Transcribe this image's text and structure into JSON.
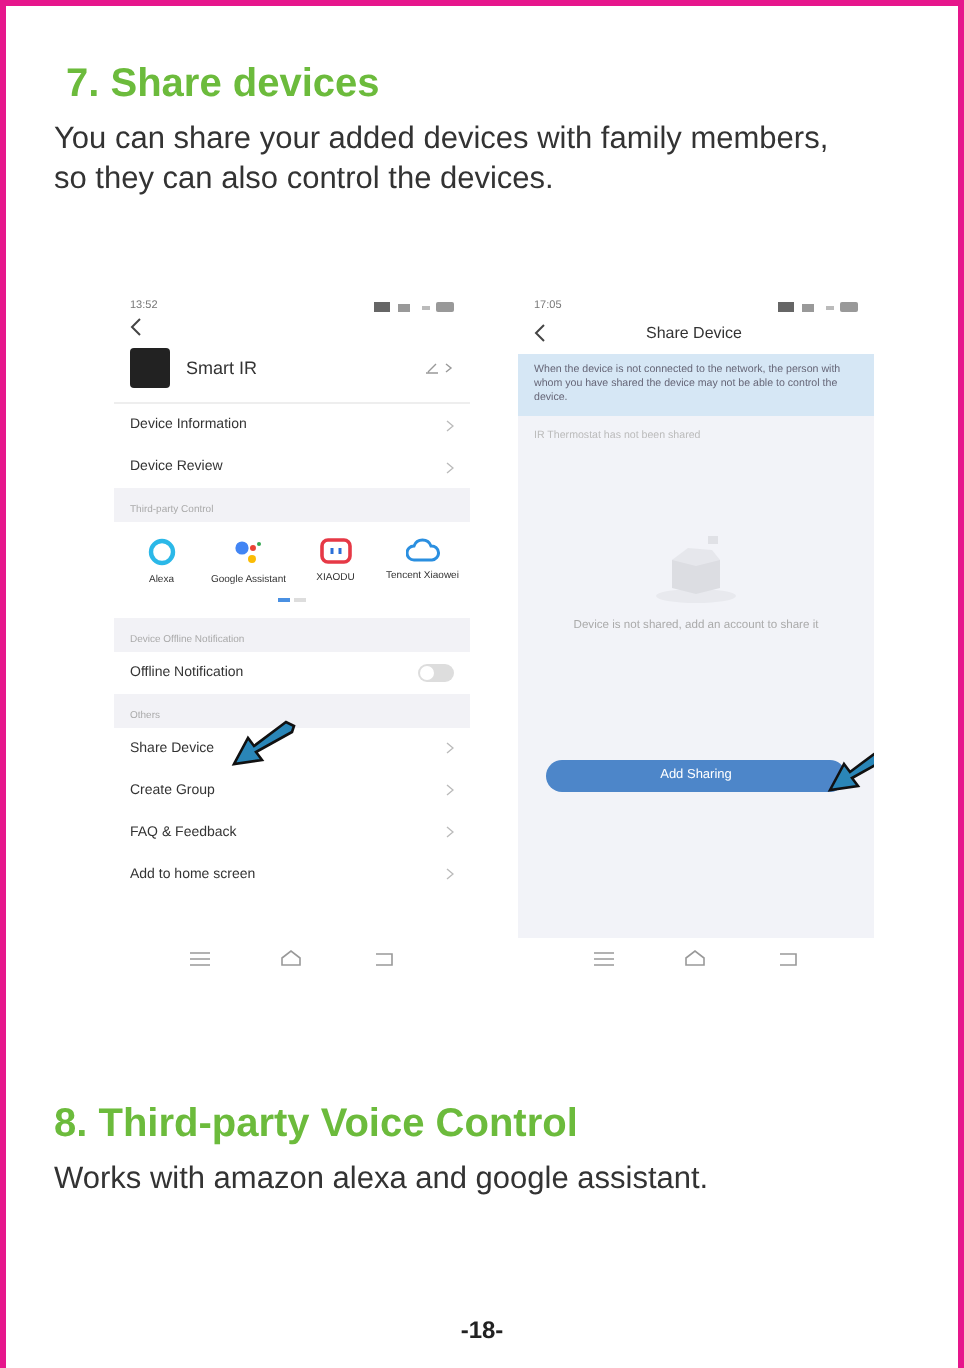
{
  "section_7": {
    "heading": "7. Share devices",
    "body": "You can share your added devices with family members, so they can also control the devices."
  },
  "device_screen": {
    "time": "13:52",
    "device_name": "Smart IR",
    "rows": [
      {
        "label": "Device Information"
      },
      {
        "label": "Device Review"
      }
    ],
    "integrations_header": "Third-party Control",
    "integrations": [
      {
        "kind": "ring",
        "label": "Alexa"
      },
      {
        "kind": "dots",
        "label": "Google Assistant"
      },
      {
        "kind": "face",
        "label": "XIAODU"
      },
      {
        "kind": "cloud",
        "label": "Tencent Xiaowei"
      }
    ],
    "pages": [
      {
        "selected": true
      },
      {
        "selected": false
      }
    ],
    "notification_header": "Device Offline Notification",
    "notification": {
      "label": "Offline Notification",
      "on": false
    },
    "others_header": "Others",
    "others": [
      {
        "label": "Share Device",
        "pointed": true
      },
      {
        "label": "Create Group",
        "pointed": false
      },
      {
        "label": "FAQ & Feedback",
        "pointed": false
      },
      {
        "label": "Add to home screen",
        "pointed": false
      }
    ]
  },
  "share_screen": {
    "time": "17:05",
    "title": "Share Device",
    "notice": "When the device is not connected to the network, the person with whom you have shared the device may not be able to control the device.",
    "list_label": "IR Thermostat has not been shared",
    "empty_message": "Device is not shared, add an account to share it",
    "button": "Add Sharing"
  },
  "section_8": {
    "heading": "8. Third-party Voice Control",
    "body": "Works with amazon alexa and google assistant."
  },
  "page_number": "-18-"
}
